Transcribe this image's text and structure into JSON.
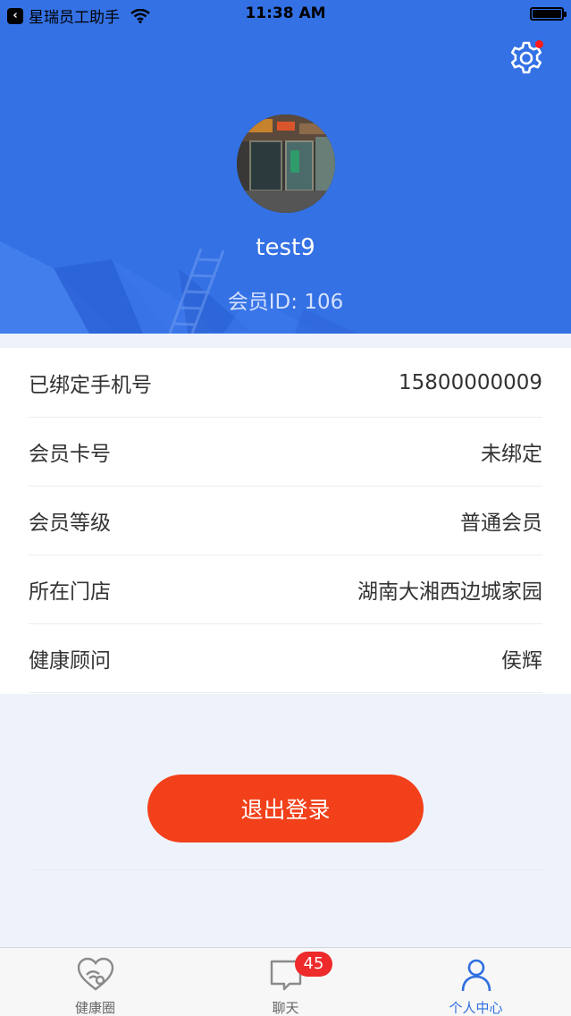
{
  "status_bar": {
    "back_app": "星瑞员工助手",
    "time": "11:38 AM"
  },
  "profile": {
    "username": "test9",
    "member_id_label": "会员ID: 106"
  },
  "info_rows": [
    {
      "label": "已绑定手机号",
      "value": "15800000009"
    },
    {
      "label": "会员卡号",
      "value": "未绑定"
    },
    {
      "label": "会员等级",
      "value": "普通会员"
    },
    {
      "label": "所在门店",
      "value": "湖南大湘西边城家园"
    },
    {
      "label": "健康顾问",
      "value": "侯辉"
    }
  ],
  "logout_label": "退出登录",
  "tabbar": {
    "tabs": [
      {
        "label": "健康圈",
        "icon": "health-circle-icon"
      },
      {
        "label": "聊天",
        "icon": "chat-icon",
        "badge": "45"
      },
      {
        "label": "个人中心",
        "icon": "person-icon",
        "active": true
      }
    ]
  },
  "colors": {
    "header_blue": "#3471e4",
    "logout_red": "#f2401a",
    "active_tab": "#2f6fe0",
    "badge_red": "#ee2a2a"
  }
}
